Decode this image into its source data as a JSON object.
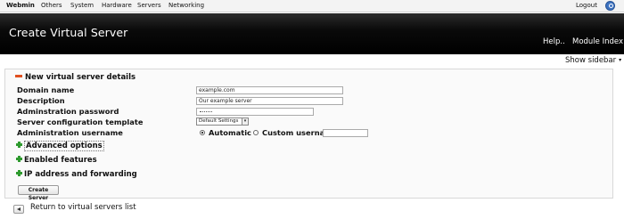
{
  "topbar": {
    "items": [
      "Webmin",
      "Others",
      "System",
      "Hardware",
      "Servers",
      "Networking"
    ],
    "logout": "Logout",
    "search_icon": "search-icon"
  },
  "header": {
    "title": "Create Virtual Server",
    "help": "Help..",
    "module_index": "Module Index"
  },
  "sidebar_toggle": {
    "label": "Show sidebar",
    "caret": "▾"
  },
  "form": {
    "section_title": "New virtual server details",
    "fields": {
      "domain_name": {
        "label": "Domain name",
        "value": "example.com"
      },
      "description": {
        "label": "Description",
        "value": "Our example server"
      },
      "admin_password": {
        "label": "Adminstration password"
      },
      "template": {
        "label": "Server configuration template",
        "selected": "Default Settings"
      },
      "admin_username": {
        "label": "Administration username",
        "option_automatic": "Automatic",
        "option_custom": "Custom username",
        "selected": "Automatic"
      }
    },
    "sections": {
      "advanced": "Advanced options",
      "enabled": "Enabled features",
      "ip": "IP address and forwarding"
    },
    "submit": "Create Server"
  },
  "footer": {
    "return_link": "Return to virtual servers list"
  },
  "colors": {
    "header_bg": "#000000",
    "minus": "#e05020",
    "plus": "#2e9a2e",
    "search": "#3d72c0"
  }
}
